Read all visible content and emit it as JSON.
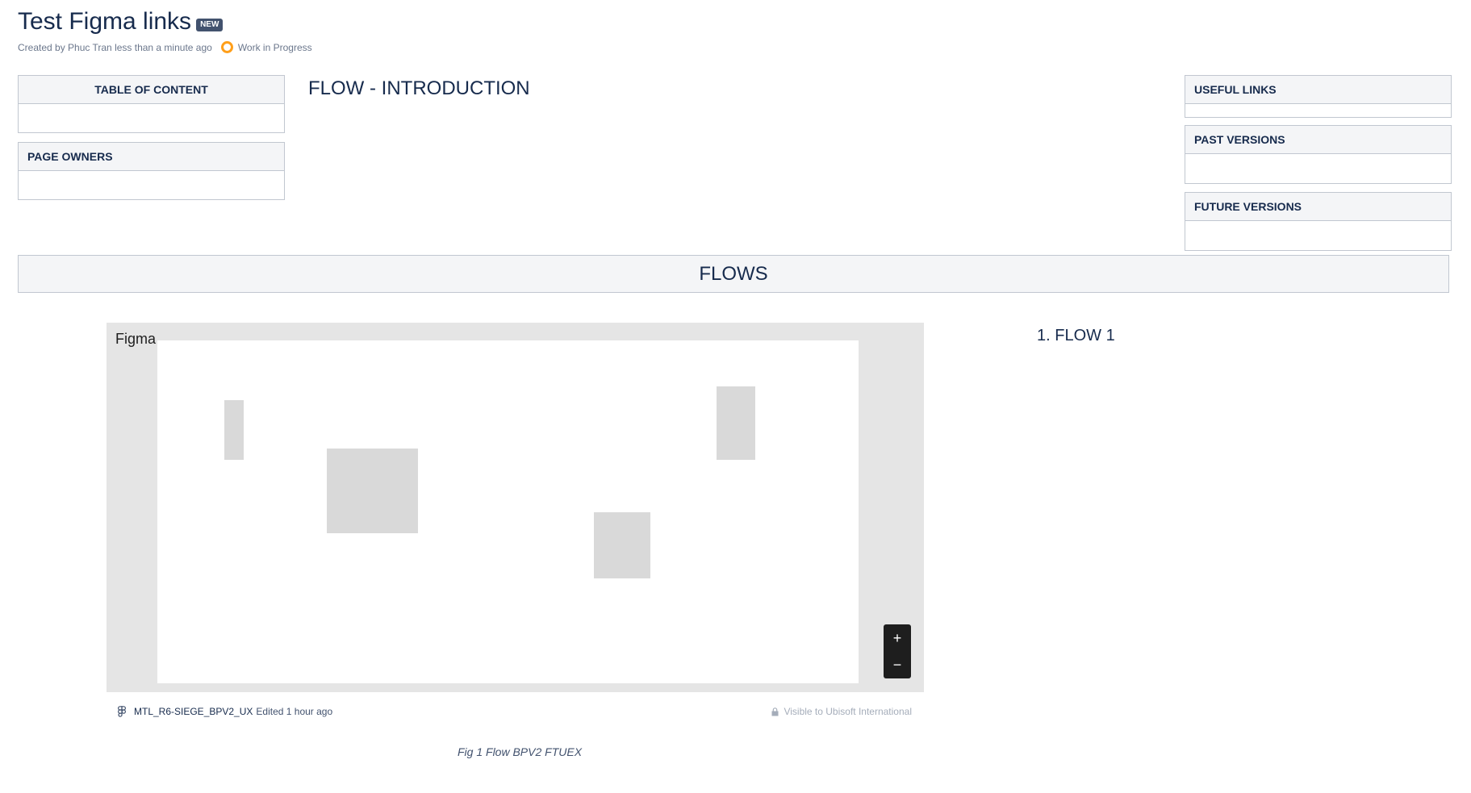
{
  "page": {
    "title": "Test Figma links",
    "badge": "NEW",
    "meta": "Created by Phuc Tran less than a minute ago",
    "status": "Work in Progress",
    "status_color": "#ff9f1a"
  },
  "panels": {
    "table_of_content": "TABLE OF CONTENT",
    "page_owners": "PAGE OWNERS",
    "useful_links": "USEFUL LINKS",
    "past_versions": "PAST VERSIONS",
    "future_versions": "FUTURE VERSIONS"
  },
  "intro_heading": "FLOW - INTRODUCTION",
  "flows_heading": "FLOWS",
  "figma_embed": {
    "label": "Figma",
    "zoom_in": "+",
    "zoom_out": "−",
    "file_name": "MTL_R6-SIEGE_BPV2_UX",
    "edited": "Edited 1 hour ago",
    "visibility": "Visible to Ubisoft International"
  },
  "caption": "Fig 1 Flow BPV2 FTUEX",
  "flow_list": [
    "1. FLOW 1"
  ],
  "icons": {
    "figma": "figma-icon",
    "lock": "lock-icon",
    "status": "status-dot-icon"
  }
}
